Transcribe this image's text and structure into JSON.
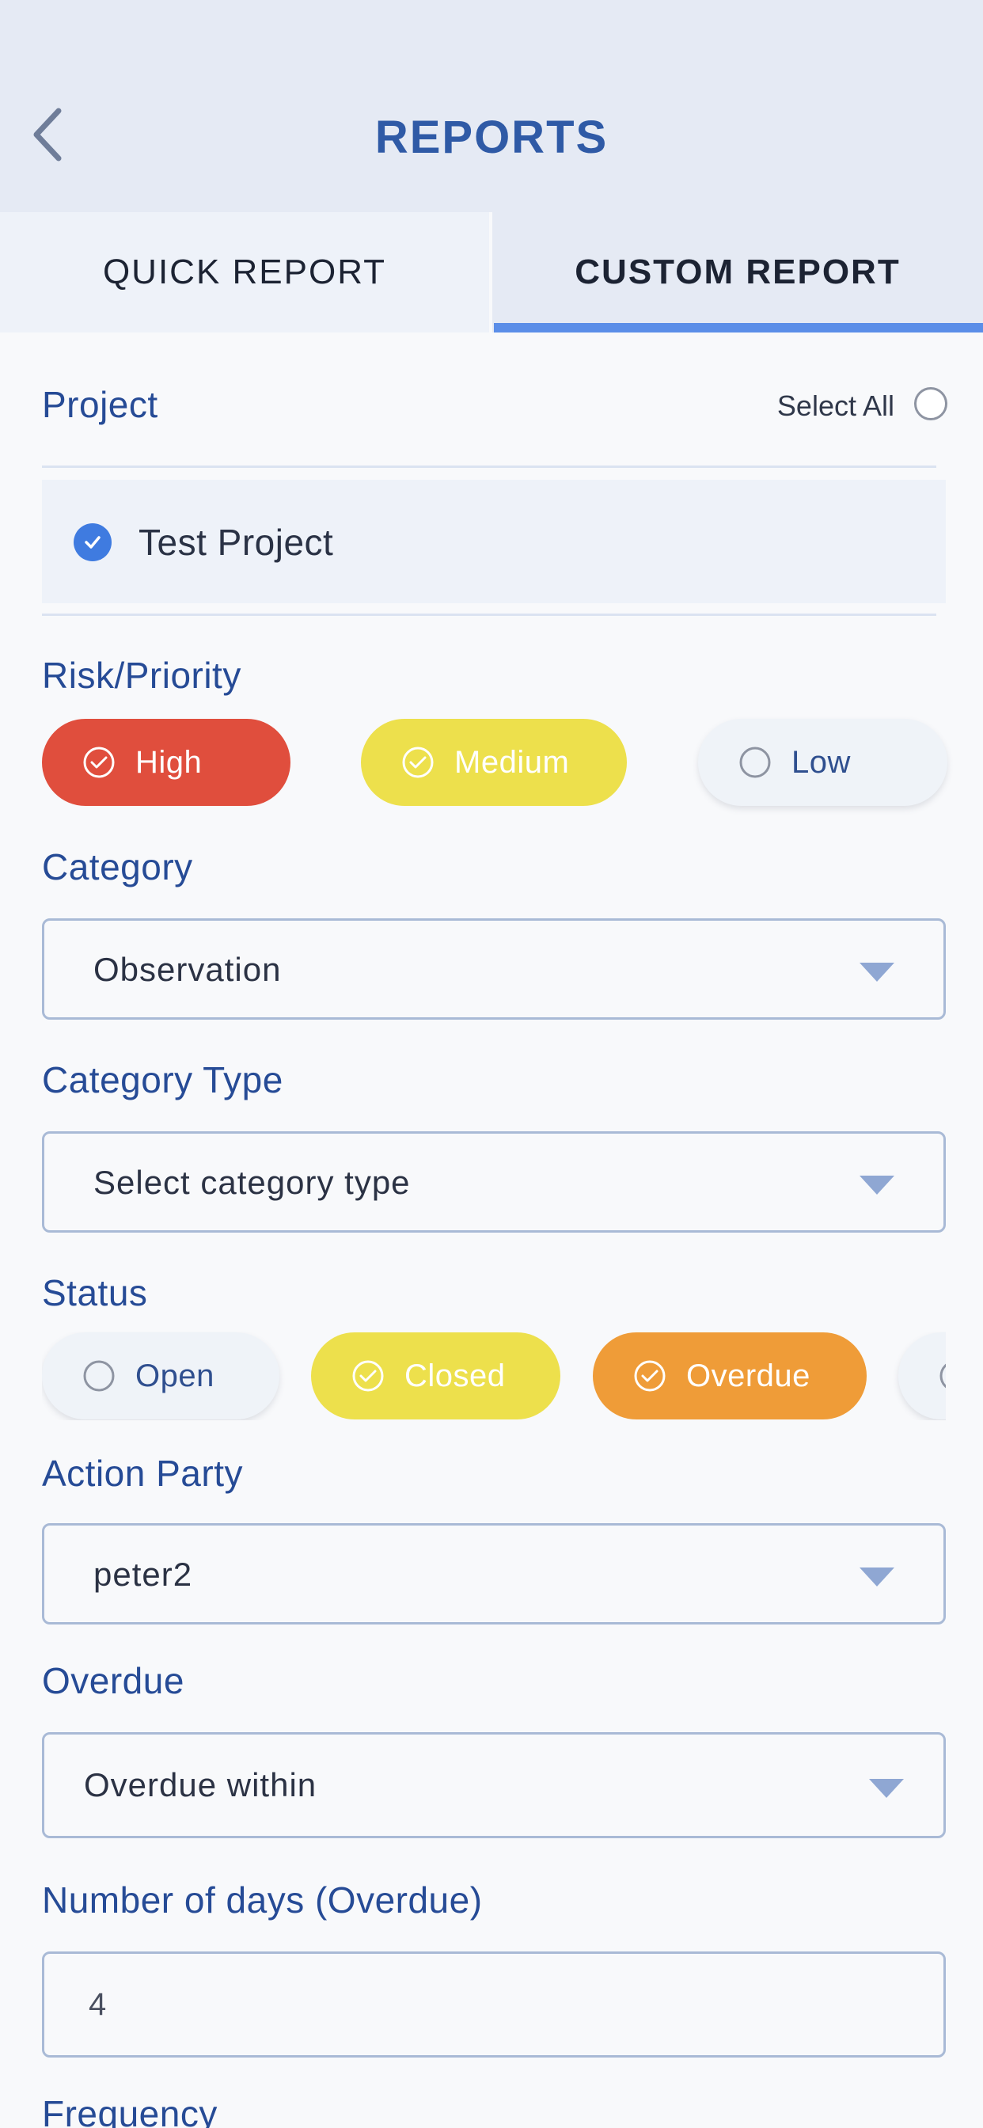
{
  "header": {
    "title": "REPORTS",
    "back_icon": "chevron-left-icon"
  },
  "tabs": [
    {
      "label": "QUICK REPORT",
      "active": false
    },
    {
      "label": "CUSTOM REPORT",
      "active": true
    }
  ],
  "project": {
    "label": "Project",
    "select_all_label": "Select All",
    "select_all_checked": false,
    "items": [
      {
        "name": "Test Project",
        "checked": true
      }
    ]
  },
  "risk_priority": {
    "label": "Risk/Priority",
    "options": [
      {
        "label": "High",
        "selected": true,
        "color": "#e04e3d"
      },
      {
        "label": "Medium",
        "selected": true,
        "color": "#ede04c"
      },
      {
        "label": "Low",
        "selected": false,
        "color": "#eff3f8"
      }
    ]
  },
  "category": {
    "label": "Category",
    "value": "Observation"
  },
  "category_type": {
    "label": "Category Type",
    "value": "Select category type"
  },
  "status": {
    "label": "Status",
    "options": [
      {
        "label": "Open",
        "selected": false,
        "color": "#eff3f8"
      },
      {
        "label": "Closed",
        "selected": true,
        "color": "#ede04c"
      },
      {
        "label": "Overdue",
        "selected": true,
        "color": "#ef9c38"
      }
    ]
  },
  "action_party": {
    "label": "Action Party",
    "value": "peter2"
  },
  "overdue": {
    "label": "Overdue",
    "value": "Overdue within"
  },
  "overdue_days": {
    "label": "Number of days (Overdue)",
    "value": "4"
  },
  "frequency": {
    "label": "Frequency"
  },
  "colors": {
    "accent": "#5b8ee8",
    "label_blue": "#264b96",
    "header_bg": "#e5eaf4"
  }
}
